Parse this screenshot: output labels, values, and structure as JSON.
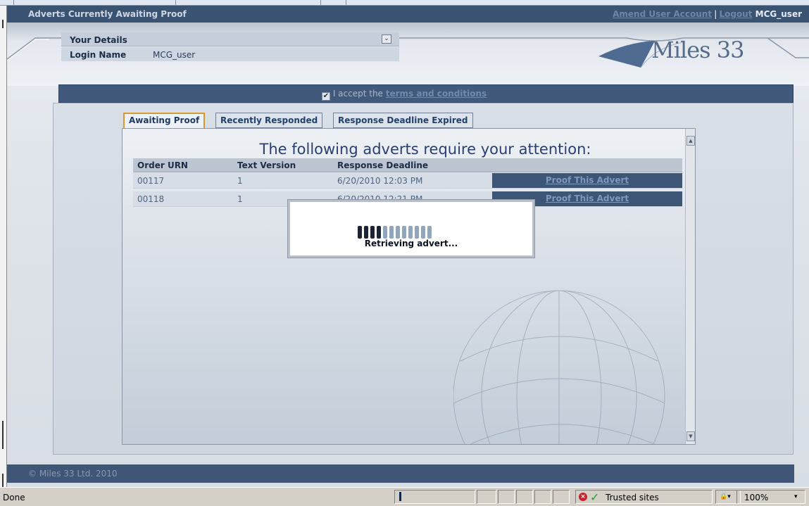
{
  "header": {
    "title": "Adverts Currently Awaiting Proof",
    "amend_link": "Amend User Account",
    "separator": "|",
    "logout_link": "Logout",
    "username": "MCG_user"
  },
  "details": {
    "section_label": "Your Details",
    "login_label": "Login Name",
    "login_value": "MCG_user",
    "toggle_glyph": "⌄"
  },
  "logo": {
    "text": "Miles 33"
  },
  "terms": {
    "checkbox_glyph": "✔",
    "prefix": "I accept the ",
    "link": "terms and conditions",
    "checked": true
  },
  "tabs": [
    {
      "label": "Awaiting Proof",
      "active": true
    },
    {
      "label": "Recently Responded",
      "active": false
    },
    {
      "label": "Response Deadline Expired",
      "active": false
    }
  ],
  "main": {
    "heading": "The following adverts require your attention:",
    "columns": [
      "Order URN",
      "Text Version",
      "Response Deadline",
      ""
    ],
    "rows": [
      {
        "urn": "00117",
        "version": "1",
        "deadline": "6/20/2010 12:03 PM",
        "action": "Proof This Advert"
      },
      {
        "urn": "00118",
        "version": "1",
        "deadline": "6/20/2010 12:21 PM",
        "action": "Proof This Advert"
      }
    ]
  },
  "modal": {
    "message": "Retrieving advert...",
    "progress_segments_total": 16,
    "progress_segments_done": 4
  },
  "footer": {
    "copyright": "© Miles 33 Ltd. 2010"
  },
  "statusbar": {
    "status": "Done",
    "zone": "Trusted sites",
    "zoom": "100%"
  },
  "colors": {
    "header_bg": "#3b5373",
    "accent_tab_border": "#d79a33",
    "proof_button_bg": "#3e5675",
    "progress_done": "#1c2433",
    "progress_pending": "#8fa6bb"
  }
}
